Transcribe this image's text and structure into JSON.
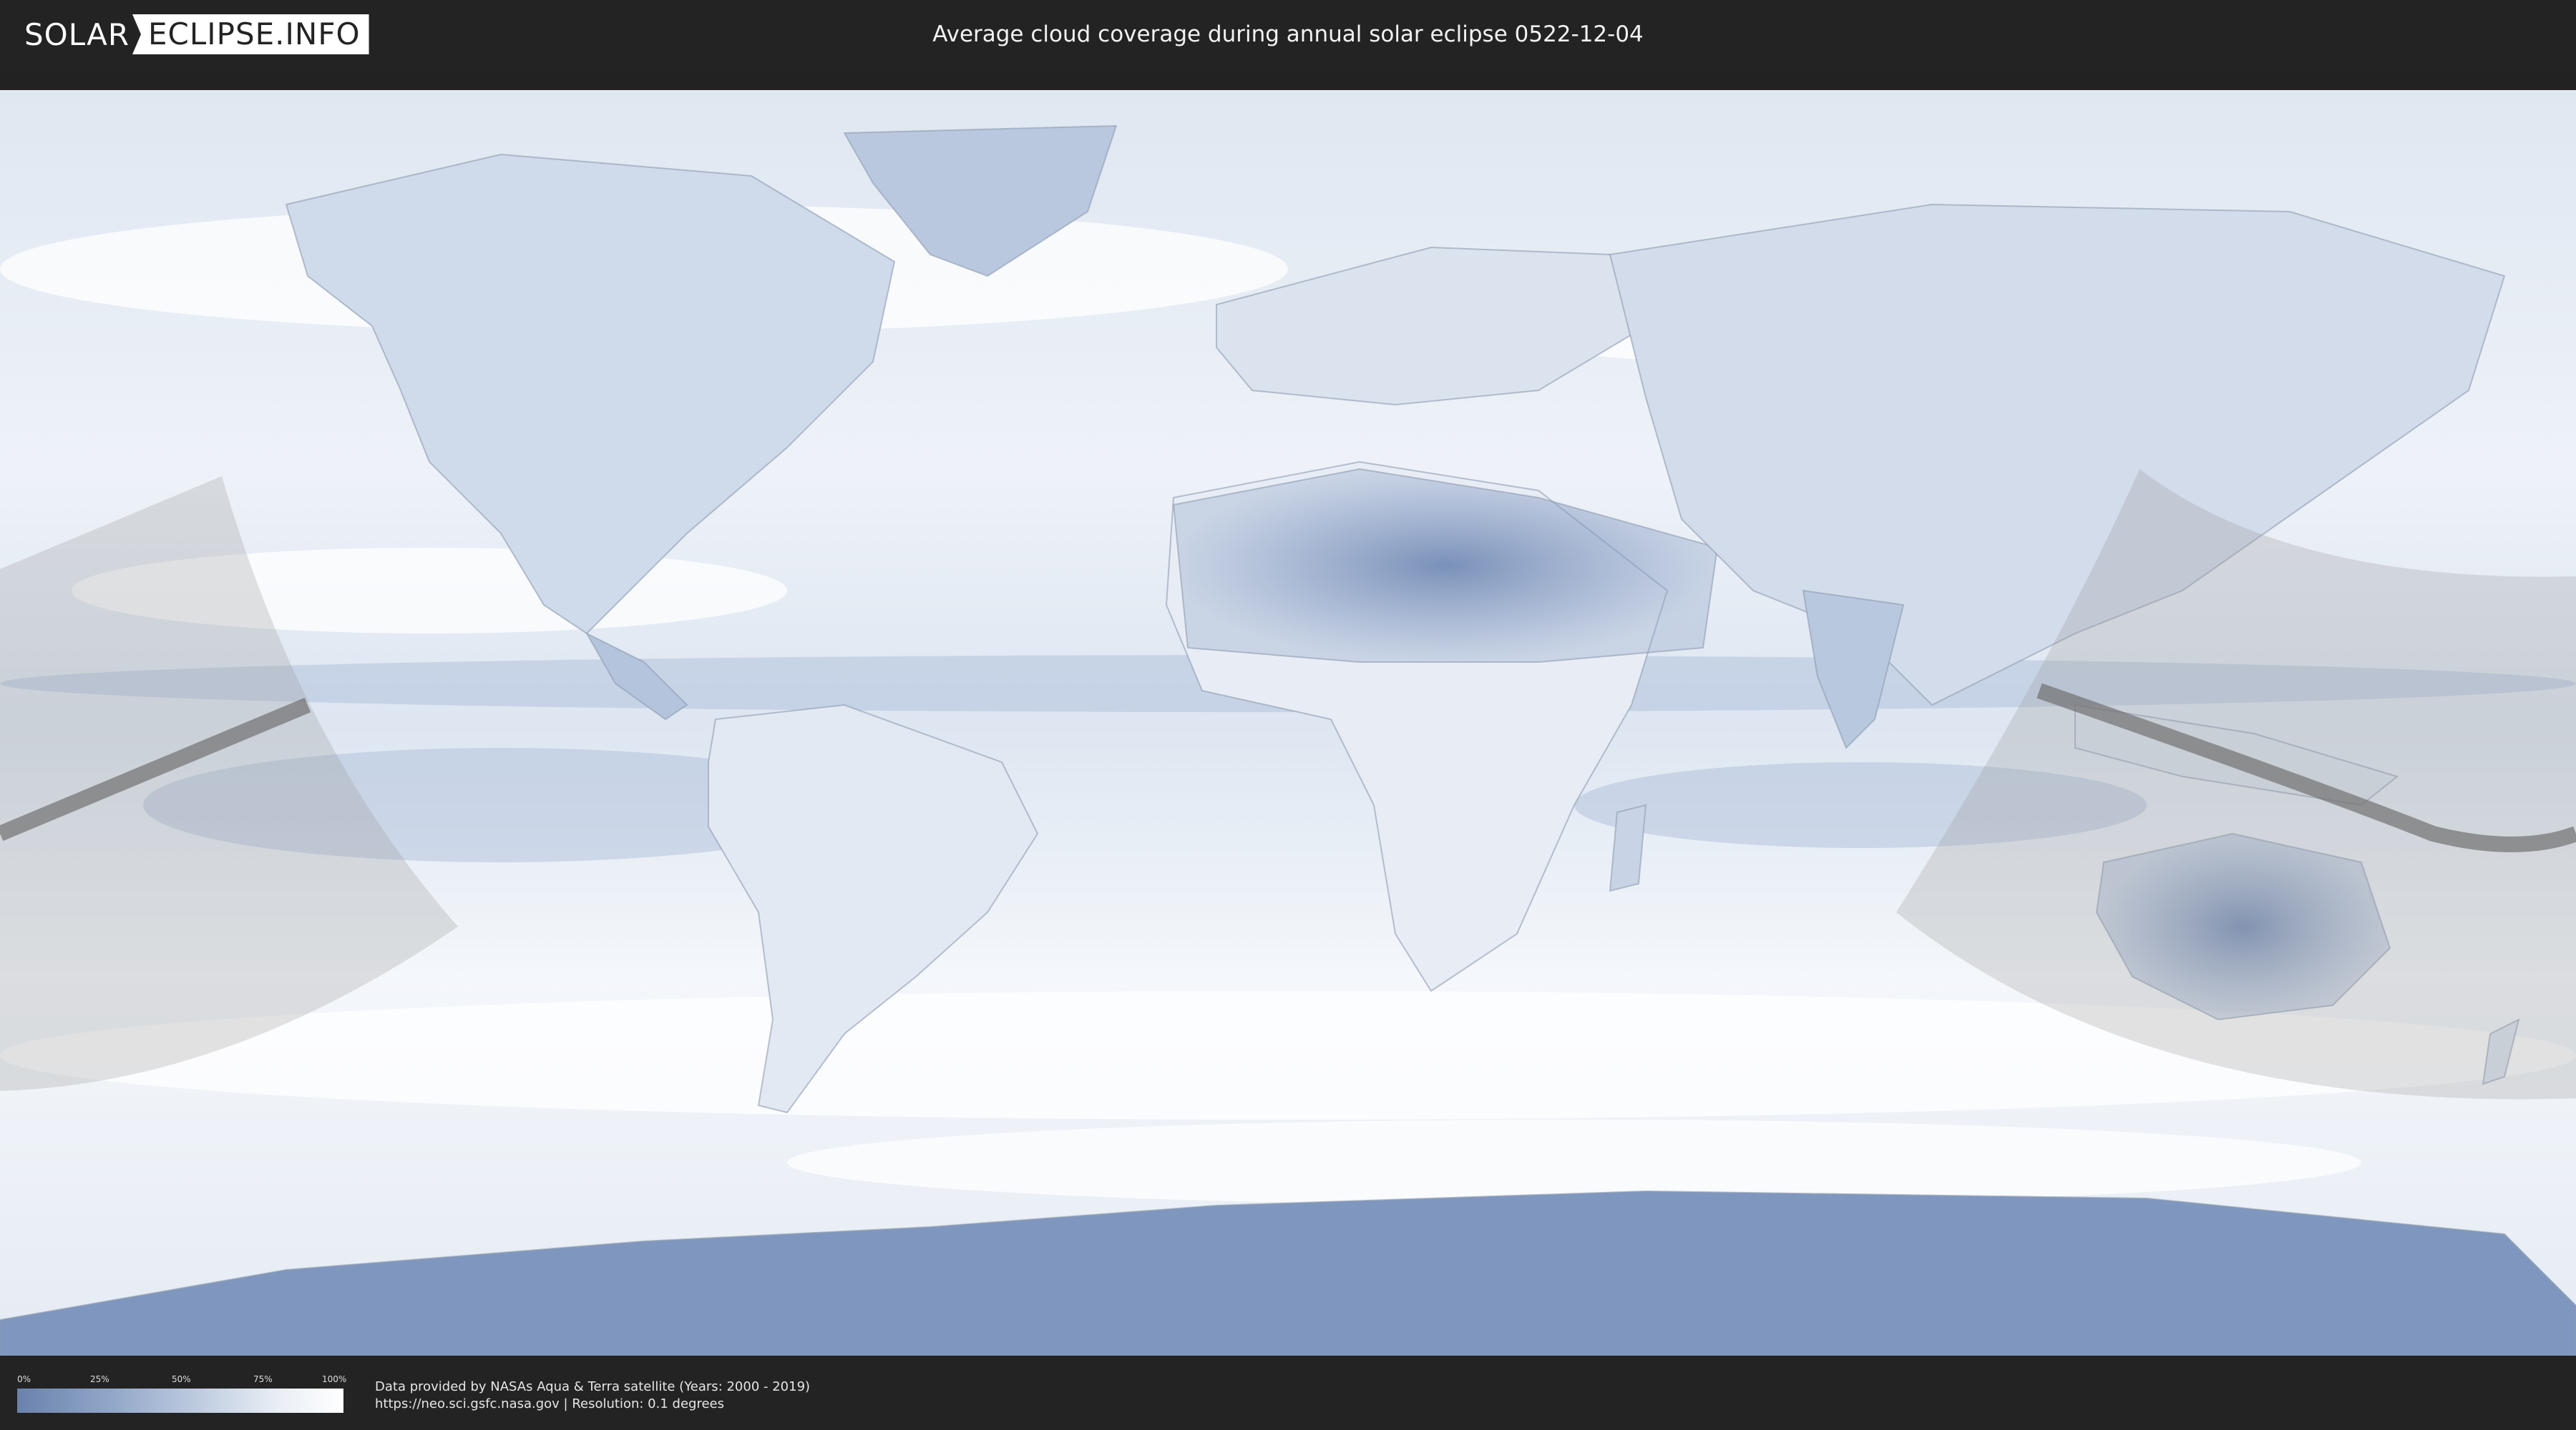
{
  "header": {
    "logo_left": "SOLAR",
    "logo_right": "ECLIPSE.INFO",
    "title": "Average cloud coverage during annual solar eclipse 0522-12-04"
  },
  "legend": {
    "ticks": [
      "0%",
      "25%",
      "50%",
      "75%",
      "100%"
    ],
    "colors": {
      "low": "#6a82ad",
      "mid": "#c6d2e4",
      "high": "#ffffff"
    }
  },
  "footer": {
    "credit_line1": "Data provided by NASAs Aqua & Terra satellite (Years: 2000 - 2019)",
    "credit_line2": "https://neo.sci.gsfc.nasa.gov | Resolution: 0.1 degrees"
  },
  "map": {
    "projection": "equirectangular world map",
    "eclipse_shadow_color": "#9a9a9a",
    "central_line_color": "#707070",
    "cloud_low_color": "#5f7aa8",
    "cloud_high_color": "#ffffff"
  }
}
